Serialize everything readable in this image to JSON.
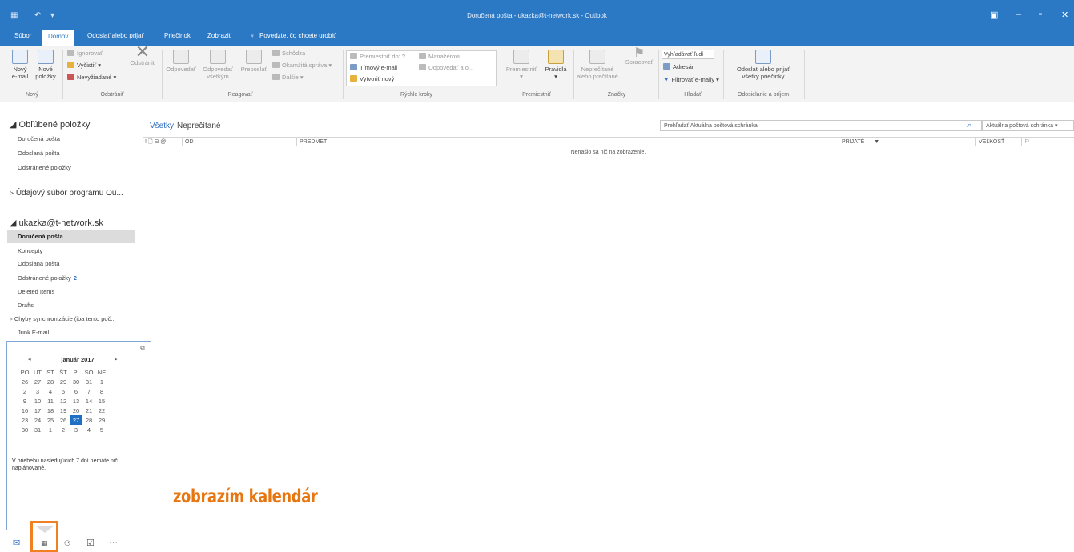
{
  "titlebar": {
    "title": "Doručená pošta - ukazka@t-network.sk - Outlook",
    "qa_icons": [
      "save-icon",
      "undo-icon",
      "customize-icon"
    ],
    "win_icons": [
      "ribbon-display-icon",
      "minimize-icon",
      "maximize-icon",
      "close-icon"
    ]
  },
  "tabs": {
    "file": "Súbor",
    "home": "Domov",
    "send_receive": "Odoslať alebo prijať",
    "folder": "Priečinok",
    "view": "Zobraziť",
    "tell_me": "Povedzte, čo chcete urobiť"
  },
  "ribbon": {
    "new_email": [
      "Nový",
      "e-mail"
    ],
    "new_items": [
      "Nové",
      "položky"
    ],
    "group_new": "Nový",
    "ignore": "Ignorovať",
    "cleanup": "Vyčistiť",
    "junk": "Nevyžiadané",
    "delete": "Odstrániť",
    "group_delete": "Odstrániť",
    "reply": "Odpovedať",
    "reply_all": [
      "Odpovedať",
      "všetkým"
    ],
    "forward": "Preposlať",
    "meeting": "Schôdza",
    "im": "Okamžitá správa",
    "more": "Ďalšie",
    "group_respond": "Reagovať",
    "qs_move": "Premiestniť do: ?",
    "qs_manager": "Manažérovi",
    "qs_team": "Tímový e-mail",
    "qs_reply_delete": "Odpovedať a o...",
    "qs_create": "Vytvoriť nový",
    "group_quicksteps": "Rýchle kroky",
    "move": "Premiestniť",
    "rules": "Pravidlá",
    "group_move": "Premiestniť",
    "unread": [
      "Neprečítané",
      "alebo prečítané"
    ],
    "followup": "Spracovať",
    "group_tags": "Značky",
    "search_people": "Vyhľadávať ľudí",
    "address_book": "Adresár",
    "filter_email": "Filtrovať e-maily",
    "group_find": "Hľadať",
    "send_receive_all": [
      "Odoslať alebo prijať",
      "všetky priečinky"
    ],
    "group_send_receive": "Odosielanie a príjem"
  },
  "leftpane": {
    "favorites_header": "Obľúbené položky",
    "favorites": [
      "Doručená pošta",
      "Odoslaná pošta",
      "Odstránené položky"
    ],
    "data_file": "Údajový súbor programu Ou...",
    "account": "ukazka@t-network.sk",
    "folders": {
      "inbox": "Doručená pošta",
      "drafts_sk": "Koncepty",
      "sent": "Odoslaná pošta",
      "deleted_sk": "Odstránené položky",
      "deleted_count": "2",
      "deleted_items": "Deleted Items",
      "drafts": "Drafts",
      "sync_issues": "Chyby synchronizácie (iba tento poč...",
      "junk": "Junk E-mail"
    }
  },
  "calendar": {
    "month": "január 2017",
    "days": [
      "PO",
      "UT",
      "ST",
      "ŠT",
      "PI",
      "SO",
      "NE"
    ],
    "weeks": [
      [
        "26",
        "27",
        "28",
        "29",
        "30",
        "31",
        "1"
      ],
      [
        "2",
        "3",
        "4",
        "5",
        "6",
        "7",
        "8"
      ],
      [
        "9",
        "10",
        "11",
        "12",
        "13",
        "14",
        "15"
      ],
      [
        "16",
        "17",
        "18",
        "19",
        "20",
        "21",
        "22"
      ],
      [
        "23",
        "24",
        "25",
        "26",
        "27",
        "28",
        "29"
      ],
      [
        "30",
        "31",
        "1",
        "2",
        "3",
        "4",
        "5"
      ]
    ],
    "today": "27",
    "message": "V priebehu nasledujúcich 7 dní nemáte nič naplánované."
  },
  "main": {
    "view_all": "Všetky",
    "view_unread": "Neprečítané",
    "search_placeholder": "Prehľadať Aktuálna poštová schránka",
    "scope": "Aktuálna poštová schránka",
    "columns": {
      "icons": "! 🗋 ⊟ @",
      "from": "OD",
      "subject": "PREDMET",
      "received": "PRIJATÉ",
      "size": "VEĽKOSŤ",
      "flag": "⚐"
    },
    "empty": "Nenašlo sa nič na zobrazenie."
  },
  "bottomnav": [
    "mail-icon",
    "calendar-icon",
    "people-icon",
    "tasks-icon",
    "more-icon"
  ],
  "annotation": "zobrazím kalendár",
  "colors": {
    "brand_blue": "#2b78c5",
    "accent_orange": "#e87610",
    "today_blue": "#1f6fc4"
  }
}
